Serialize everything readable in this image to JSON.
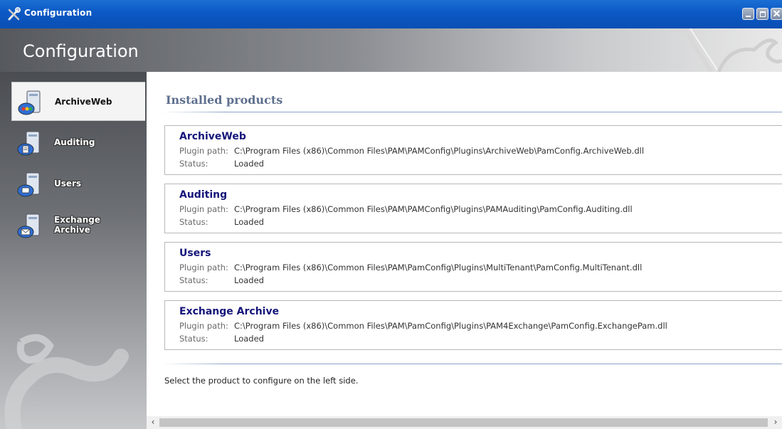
{
  "window": {
    "title": "Configuration",
    "header_title": "Configuration"
  },
  "sidebar": {
    "items": [
      {
        "label": "ArchiveWeb",
        "selected": true,
        "icon": "server-globe-icon"
      },
      {
        "label": "Auditing",
        "selected": false,
        "icon": "server-document-icon"
      },
      {
        "label": "Users",
        "selected": false,
        "icon": "server-users-icon"
      },
      {
        "label_line1": "Exchange",
        "label_line2": "Archive",
        "selected": false,
        "icon": "server-mail-icon"
      }
    ]
  },
  "main": {
    "section_title": "Installed products",
    "path_label": "Plugin path:",
    "status_label": "Status:",
    "products": [
      {
        "name": "ArchiveWeb",
        "path": "C:\\Program  Files  (x86)\\Common  Files\\PAM\\PAMConfig\\Plugins\\ArchiveWeb\\PamConfig.ArchiveWeb.dll",
        "status": "Loaded"
      },
      {
        "name": "Auditing",
        "path": "C:\\Program  Files  (x86)\\Common  Files\\PAM\\PAMConfig\\Plugins\\PAMAuditing\\PamConfig.Auditing.dll",
        "status": "Loaded"
      },
      {
        "name": "Users",
        "path": "C:\\Program  Files  (x86)\\Common  Files\\PAM\\PamConfig\\Plugins\\MultiTenant\\PamConfig.MultiTenant.dll",
        "status": "Loaded"
      },
      {
        "name": "Exchange Archive",
        "path": "C:\\Program  Files  (x86)\\Common  Files\\PAM\\PamConfig\\Plugins\\PAM4Exchange\\PamConfig.ExchangePam.dll",
        "status": "Loaded"
      }
    ],
    "hint": "Select the product to configure on the left side."
  },
  "scrollbar": {
    "left_arrow": "‹",
    "right_arrow": "›"
  }
}
